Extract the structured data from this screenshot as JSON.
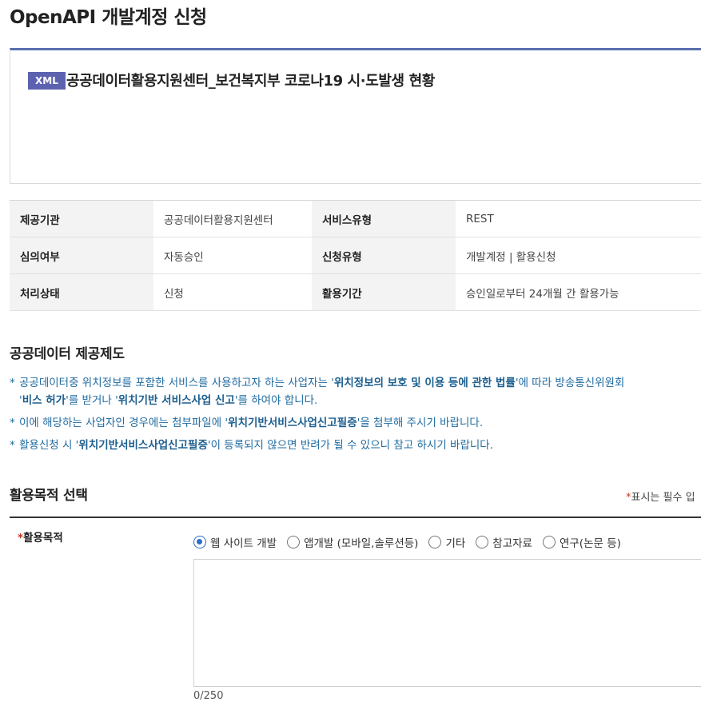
{
  "page": {
    "title": "OpenAPI 개발계정 신청"
  },
  "api_card": {
    "badge": "XML",
    "title": "공공데이터활용지원센터_보건복지부 코로나19 시·도발생 현황"
  },
  "info_table": [
    {
      "label1": "제공기관",
      "value1": "공공데이터활용지원센터",
      "label2": "서비스유형",
      "value2": "REST"
    },
    {
      "label1": "심의여부",
      "value1": "자동승인",
      "label2": "신청유형",
      "value2": "개발계정 | 활용신청"
    },
    {
      "label1": "처리상태",
      "value1": "신청",
      "label2": "활용기간",
      "value2": "승인일로부터 24개월 간 활용가능"
    }
  ],
  "policy": {
    "title": "공공데이터 제공제도",
    "bullet": "*",
    "notice1": {
      "p1": "공공데이터중 위치정보를 포함한 서비스를 사용하고자 하는 사업자는 '",
      "b1": "위치정보의 보호 및 이용 등에 관한 법률",
      "p2": "'에 따라 방송통신위원회",
      "p3": "'",
      "b2": "비스 허가",
      "p4": "'를 받거나 '",
      "b3": "위치기반 서비스사업 신고",
      "p5": "'를 하여야 합니다."
    },
    "notice2": {
      "p1": "이에 해당하는 사업자인 경우에는 첨부파일에 '",
      "b1": "위치기반서비스사업신고필증",
      "p2": "'을 첨부해 주시기 바랍니다."
    },
    "notice3": {
      "p1": "활용신청 시 '",
      "b1": "위치기반서비스사업신고필증",
      "p2": "'이 등록되지 않으면 반려가 될 수 있으니 참고 하시기 바랍니다."
    }
  },
  "purpose": {
    "section_title": "활용목적 선택",
    "required_star": "*",
    "required_note": "표시는 필수 입",
    "field_star": "*",
    "field_label": "활용목적",
    "options": [
      "웹 사이트 개발",
      "앱개발 (모바일,솔루션등)",
      "기타",
      "참고자료",
      "연구(논문 등)"
    ],
    "selected_index": 0,
    "textarea_value": "",
    "char_count": "0/250"
  },
  "colors": {
    "accent": "#5b6fae",
    "badge": "#5c62b0",
    "notice_text": "#1f6ba0",
    "radio": "#2d6fc4",
    "required": "#c0392b"
  }
}
